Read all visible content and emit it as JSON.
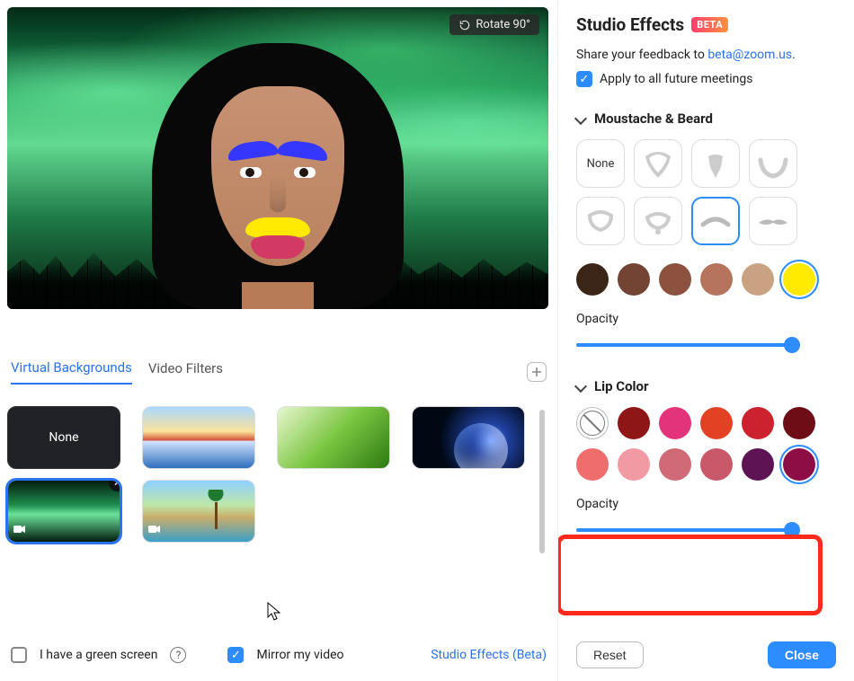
{
  "preview": {
    "rotate_label": "Rotate 90°"
  },
  "tabs": {
    "virtual_backgrounds": "Virtual Backgrounds",
    "video_filters": "Video Filters"
  },
  "thumbnails": {
    "none": "None"
  },
  "bottom": {
    "green_screen": "I have a green screen",
    "mirror": "Mirror my video",
    "studio_link": "Studio Effects (Beta)"
  },
  "panel": {
    "title": "Studio Effects",
    "beta": "BETA",
    "feedback_prefix": "Share your feedback to  ",
    "feedback_email": "beta@zoom.us",
    "apply_all": "Apply to all future meetings"
  },
  "moustache": {
    "header": "Moustache & Beard",
    "none": "None",
    "opacity_label": "Opacity",
    "opacity_value": 100,
    "colors": [
      "#3b2517",
      "#734434",
      "#8d523f",
      "#b4735a",
      "#c9a381",
      "#ffe900"
    ],
    "selected_color": "#ffe900",
    "selected_style_index": 6
  },
  "lip": {
    "header": "Lip Color",
    "opacity_label": "Opacity",
    "opacity_value": 100,
    "colors_row1": [
      "none",
      "#8e1616",
      "#e3337a",
      "#e24223",
      "#cb222e",
      "#6f0d17"
    ],
    "colors_row2": [
      "#ef6d6d",
      "#f19aa3",
      "#cf6a76",
      "#c95869",
      "#5e1454",
      "#8d0e45"
    ],
    "selected_color": "#8d0e45"
  },
  "footer": {
    "reset": "Reset",
    "close": "Close"
  }
}
